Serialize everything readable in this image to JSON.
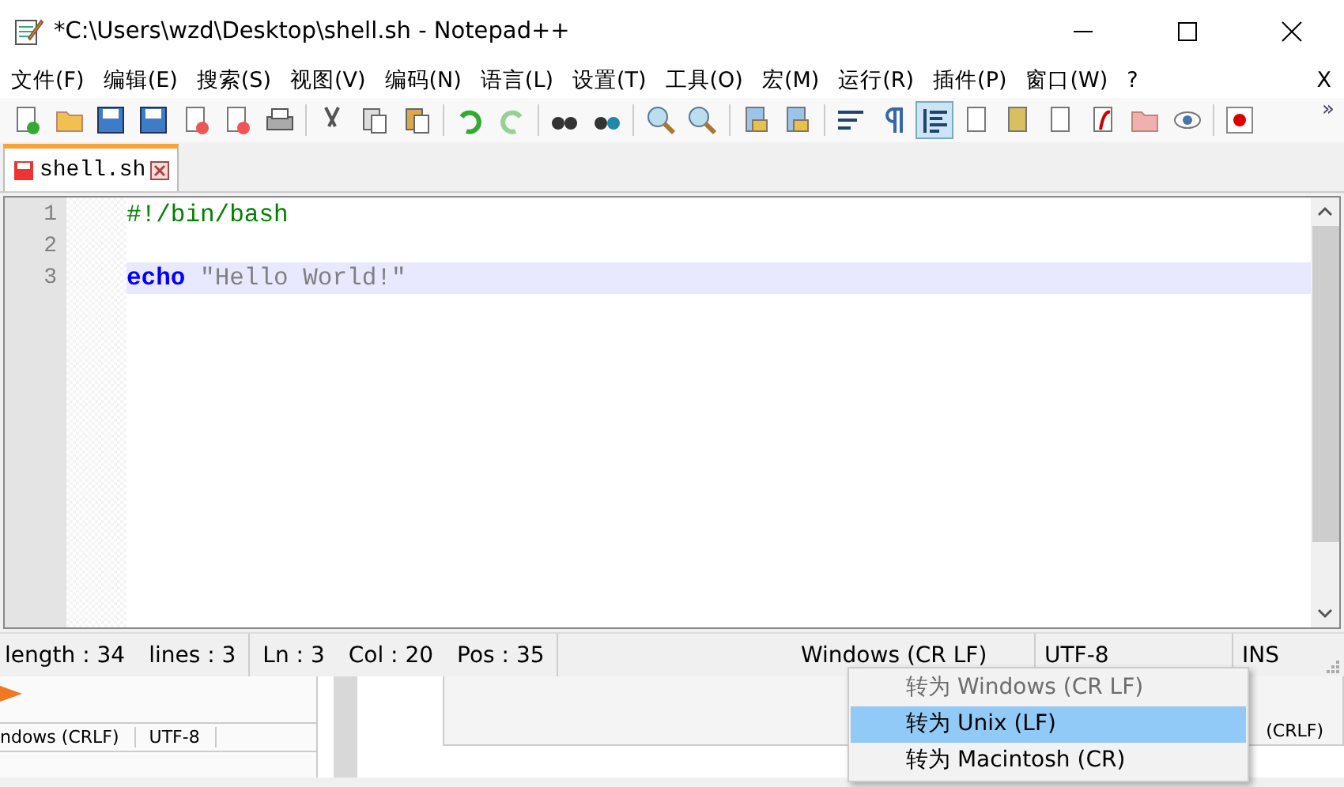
{
  "window": {
    "title": "*C:\\Users\\wzd\\Desktop\\shell.sh - Notepad++"
  },
  "menu": [
    "文件(F)",
    "编辑(E)",
    "搜索(S)",
    "视图(V)",
    "编码(N)",
    "语言(L)",
    "设置(T)",
    "工具(O)",
    "宏(M)",
    "运行(R)",
    "插件(P)",
    "窗口(W)",
    "?"
  ],
  "menu_close": "X",
  "toolbar_overflow": "»",
  "tabs": [
    {
      "label": "shell.sh",
      "selected": true,
      "modified": true
    }
  ],
  "editor": {
    "lines": [
      {
        "number": "1",
        "current": false,
        "tokens": [
          {
            "kind": "comment",
            "text": "#!/bin/bash"
          }
        ]
      },
      {
        "number": "2",
        "current": false
      },
      {
        "number": "3",
        "current": true,
        "tokens": [
          {
            "kind": "keyword",
            "text": "echo"
          },
          {
            "kind": "string",
            "text": " \"Hello World!\""
          }
        ]
      }
    ]
  },
  "status_bar": [
    [
      "length : 34",
      "lines : 3"
    ],
    [
      "Ln : 3",
      "Col : 20",
      "Pos : 35"
    ],
    [
      "Windows (CR LF)"
    ],
    [
      "UTF-8"
    ],
    [
      "INS"
    ]
  ],
  "context_menu": [
    {
      "label": "转为 Windows (CR LF)",
      "disabled": true,
      "selected": false
    },
    {
      "label": "转为 Unix (LF)",
      "disabled": false,
      "selected": true
    },
    {
      "label": "转为 Macintosh (CR)",
      "disabled": false,
      "selected": false
    }
  ],
  "background_window": {
    "left_texts": [
      "ndows (CRLF)",
      "UTF-8"
    ],
    "right_text": "(CRLF)"
  }
}
